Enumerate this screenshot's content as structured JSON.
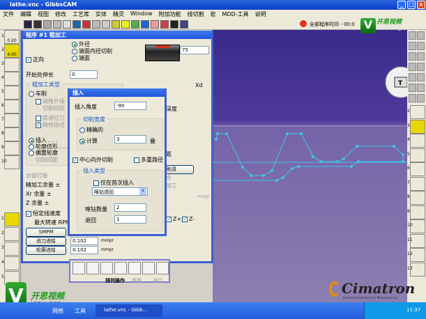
{
  "window": {
    "title": "lathe.vnc - GibbsCAM"
  },
  "menu": [
    "文件",
    "编辑",
    "视图",
    "修改",
    "工艺库",
    "实体",
    "精灵",
    "Window",
    "附加功能",
    "线切割",
    "宏",
    "MDD-工具",
    "说明"
  ],
  "status": {
    "program_time": "全部程序时间 - 00:0"
  },
  "left_tiles": {
    "top": [
      {
        "n": "1",
        "v": "0.20"
      },
      {
        "n": "2",
        "v": "4.00"
      },
      {
        "n": "3"
      },
      {
        "n": "4"
      },
      {
        "n": "5"
      },
      {
        "n": "6"
      },
      {
        "n": "7"
      },
      {
        "n": "8"
      },
      {
        "n": "9"
      },
      {
        "n": "10"
      }
    ],
    "bottom": [
      "1",
      "2",
      "3",
      "4",
      "5"
    ]
  },
  "right_tiles": [
    "2",
    "3",
    "4",
    "5",
    "6",
    "7",
    "8",
    "9",
    "10",
    "11",
    "12",
    "13"
  ],
  "program_dialog": {
    "title": "程序 #1 粗加工",
    "direction_forward": "正向",
    "mode_options": [
      "外径",
      "端面内径切削",
      "端面"
    ],
    "dim_value": "75",
    "start_ext_label": "开始处伸长",
    "start_ext_value": "0",
    "rough_type_group": "粗加工类型",
    "turn": "车削",
    "chamfer": "调角外缘",
    "cut_width": "切削间距",
    "no_pullback": "禁退拉刀",
    "finish_path": "精修路径",
    "insert": "插入 . . .",
    "contour_follow": "轮廓仿形 . . .",
    "offset_contour": "偏置轮廓",
    "cut_width2": "切削间距",
    "stock_clear": "余留打断",
    "finish_allowance": "精加工余量 ±",
    "xr_allowance": "Xr 余量 ±",
    "z_allowance": "Z 余量 ±",
    "css_label": "恒定线速度",
    "max_rpm": "最大转速 RPM",
    "smpm_button": "SMPM",
    "plunge_feed_button": "进刀进给",
    "plunge_feed": "0.102",
    "contour_feed_button": "轮廓进给",
    "contour_feed": "0.102",
    "feed_unit": "mmpr",
    "right_labels": {
      "xd": "Xd",
      "depth": "深度",
      "spacing": "距",
      "tool_btn": "削清",
      "margin": "余",
      "machining": "加工",
      "unit": "mmpr",
      "z_plus": "Z+",
      "z_minus": "Z-"
    }
  },
  "insert_dialog": {
    "title": "插入",
    "angle_label": "插入角度",
    "angle_value": "-90",
    "cut_width_group": "切削宽度",
    "exact": "精确的",
    "calc": "计算",
    "calc_value": "3",
    "calc_unit": "叠",
    "center_out": "中心向外切削",
    "multi_path": "多重路径",
    "insert_type_group": "插入类型",
    "first_only": "仅在首次插入",
    "select_value": "啄钻退回",
    "peck_count_label": "啄钻数量",
    "peck_count": "2",
    "retract_label": "退回",
    "retract_value": "1"
  },
  "bottom_panel": {
    "reorder": "排列操作",
    "redo": "重做",
    "run": "进行"
  },
  "watermark": {
    "brand": "开思视频",
    "site": "icax.org"
  },
  "logo": {
    "name": "Cimatron",
    "tagline": "Innovative Solutions for Manufacturing"
  },
  "taskbar": {
    "network": "网络",
    "tools": "工具",
    "task": "lathe.vnc - Gibb...",
    "clock": "11:37"
  },
  "colors": {
    "toolpath": "#3cc8e8",
    "dialog_border": "#3d5fd0",
    "highlight_tile": "#e8d800"
  }
}
